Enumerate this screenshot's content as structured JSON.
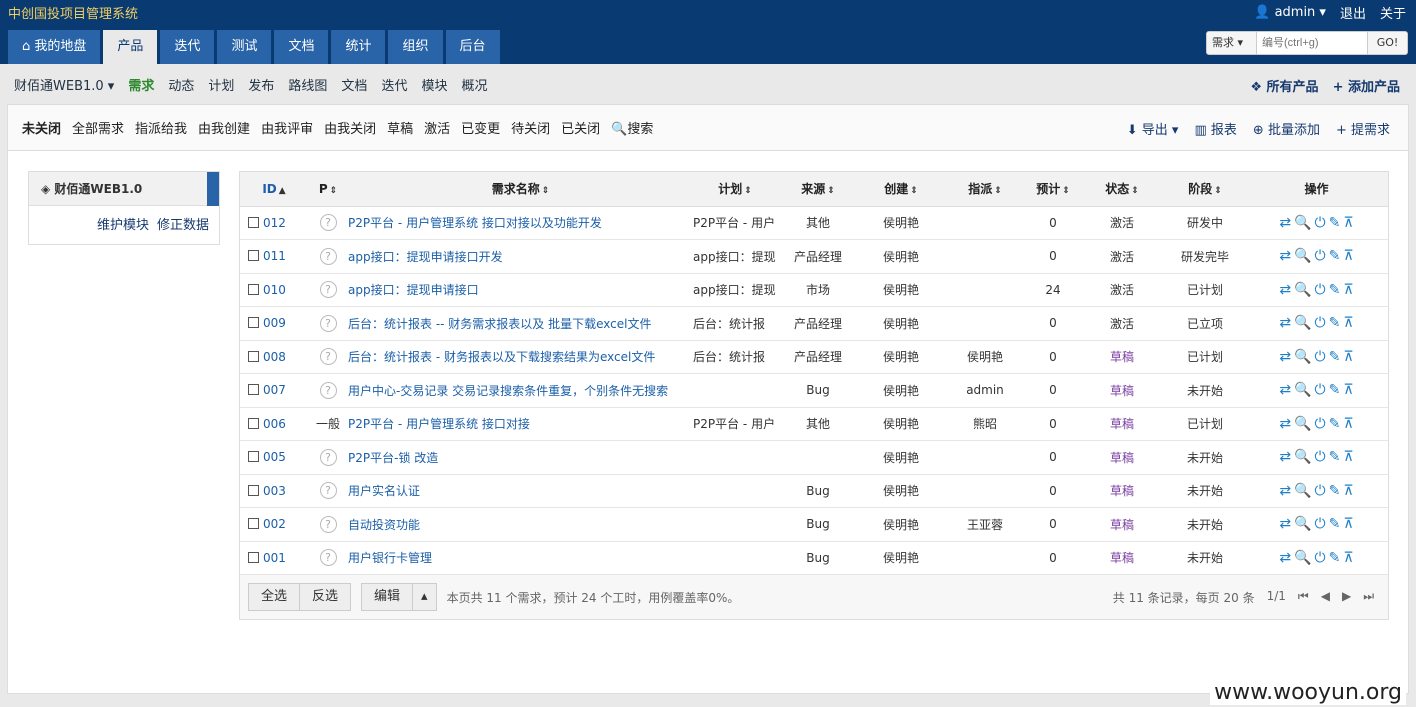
{
  "app_title": "中创国投项目管理系统",
  "user": {
    "name": "admin",
    "logout": "退出",
    "about": "关于"
  },
  "nav": {
    "tabs": [
      "我的地盘",
      "产品",
      "迭代",
      "测试",
      "文档",
      "统计",
      "组织",
      "后台"
    ]
  },
  "search": {
    "type": "需求",
    "placeholder": "编号(ctrl+g)",
    "go": "GO!"
  },
  "subnav": {
    "product": "财佰通WEB1.0",
    "items": [
      "需求",
      "动态",
      "计划",
      "发布",
      "路线图",
      "文档",
      "迭代",
      "模块",
      "概况"
    ],
    "all_products": "所有产品",
    "add_product": "添加产品"
  },
  "filters": {
    "items": [
      "未关闭",
      "全部需求",
      "指派给我",
      "由我创建",
      "由我评审",
      "由我关闭",
      "草稿",
      "激活",
      "已变更",
      "待关闭",
      "已关闭",
      "搜索"
    ],
    "export": "导出",
    "report": "报表",
    "batch_add": "批量添加",
    "add_story": "提需求"
  },
  "tree": {
    "title": "财佰通WEB1.0",
    "maintain": "维护模块",
    "fix": "修正数据"
  },
  "table": {
    "headers": [
      "ID",
      "P",
      "需求名称",
      "计划",
      "来源",
      "创建",
      "指派",
      "预计",
      "状态",
      "阶段",
      "操作"
    ],
    "rows": [
      {
        "id": "012",
        "p": "?",
        "name": "P2P平台 - 用户管理系统 接口对接以及功能开发",
        "plan": "P2P平台 - 用户",
        "source": "其他",
        "creator": "侯明艳",
        "assign": "",
        "estimate": "0",
        "status": "激活",
        "stage": "研发中"
      },
      {
        "id": "011",
        "p": "?",
        "name": "app接口：提现申请接口开发",
        "plan": "app接口：提现",
        "source": "产品经理",
        "creator": "侯明艳",
        "assign": "",
        "estimate": "0",
        "status": "激活",
        "stage": "研发完毕"
      },
      {
        "id": "010",
        "p": "?",
        "name": "app接口：提现申请接口",
        "plan": "app接口：提现",
        "source": "市场",
        "creator": "侯明艳",
        "assign": "",
        "estimate": "24",
        "status": "激活",
        "stage": "已计划"
      },
      {
        "id": "009",
        "p": "?",
        "name": "后台：统计报表 -- 财务需求报表以及 批量下载excel文件",
        "plan": "后台：统计报",
        "source": "产品经理",
        "creator": "侯明艳",
        "assign": "",
        "estimate": "0",
        "status": "激活",
        "stage": "已立项"
      },
      {
        "id": "008",
        "p": "?",
        "name": "后台：统计报表 - 财务报表以及下载搜索结果为excel文件",
        "plan": "后台：统计报",
        "source": "产品经理",
        "creator": "侯明艳",
        "assign": "侯明艳",
        "estimate": "0",
        "status": "草稿",
        "stage": "已计划"
      },
      {
        "id": "007",
        "p": "?",
        "name": "用户中心-交易记录 交易记录搜索条件重复，个别条件无搜索",
        "plan": "",
        "source": "Bug",
        "creator": "侯明艳",
        "assign": "admin",
        "estimate": "0",
        "status": "草稿",
        "stage": "未开始"
      },
      {
        "id": "006",
        "p": "一般",
        "name": "P2P平台 - 用户管理系统 接口对接",
        "plan": "P2P平台 - 用户",
        "source": "其他",
        "creator": "侯明艳",
        "assign": "熊昭",
        "estimate": "0",
        "status": "草稿",
        "stage": "已计划"
      },
      {
        "id": "005",
        "p": "?",
        "name": "P2P平台-锁 改造",
        "plan": "",
        "source": "",
        "creator": "侯明艳",
        "assign": "",
        "estimate": "0",
        "status": "草稿",
        "stage": "未开始"
      },
      {
        "id": "003",
        "p": "?",
        "name": "用户实名认证",
        "plan": "",
        "source": "Bug",
        "creator": "侯明艳",
        "assign": "",
        "estimate": "0",
        "status": "草稿",
        "stage": "未开始"
      },
      {
        "id": "002",
        "p": "?",
        "name": "自动投资功能",
        "plan": "",
        "source": "Bug",
        "creator": "侯明艳",
        "assign": "王亚蓉",
        "estimate": "0",
        "status": "草稿",
        "stage": "未开始"
      },
      {
        "id": "001",
        "p": "?",
        "name": "用户银行卡管理",
        "plan": "",
        "source": "Bug",
        "creator": "侯明艳",
        "assign": "",
        "estimate": "0",
        "status": "草稿",
        "stage": "未开始"
      }
    ]
  },
  "footer": {
    "select_all": "全选",
    "invert": "反选",
    "edit": "编辑",
    "info": "本页共 11 个需求，预计 24 个工时，用例覆盖率0%。",
    "pager": "共 11 条记录，每页 20 条",
    "page": "1/1"
  },
  "watermark": "www.wooyun.org"
}
